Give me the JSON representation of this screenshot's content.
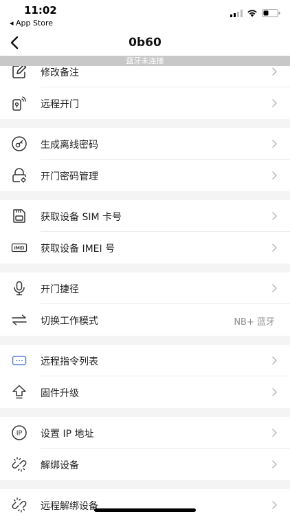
{
  "status_bar": {
    "time": "11:02",
    "back_app": "◂ App Store"
  },
  "nav": {
    "title": "0b60"
  },
  "banner": {
    "text": "蓝牙未连接"
  },
  "menu": {
    "edit_note": "修改备注",
    "remote_open": "远程开门",
    "gen_offline_pwd": "生成离线密码",
    "door_pwd_mgmt": "开门密码管理",
    "get_sim": "获取设备 SIM 卡号",
    "get_imei": "获取设备 IMEI 号",
    "open_shortcut": "开门捷径",
    "switch_mode": "切换工作模式",
    "switch_mode_value": "NB+ 蓝牙",
    "remote_cmd_list": "远程指令列表",
    "firmware_upgrade": "固件升级",
    "set_ip": "设置 IP 地址",
    "unbind": "解绑设备",
    "remote_unbind": "远程解绑设备"
  },
  "icons": {
    "imei_text": "IMEI",
    "ip_text": "IP"
  }
}
